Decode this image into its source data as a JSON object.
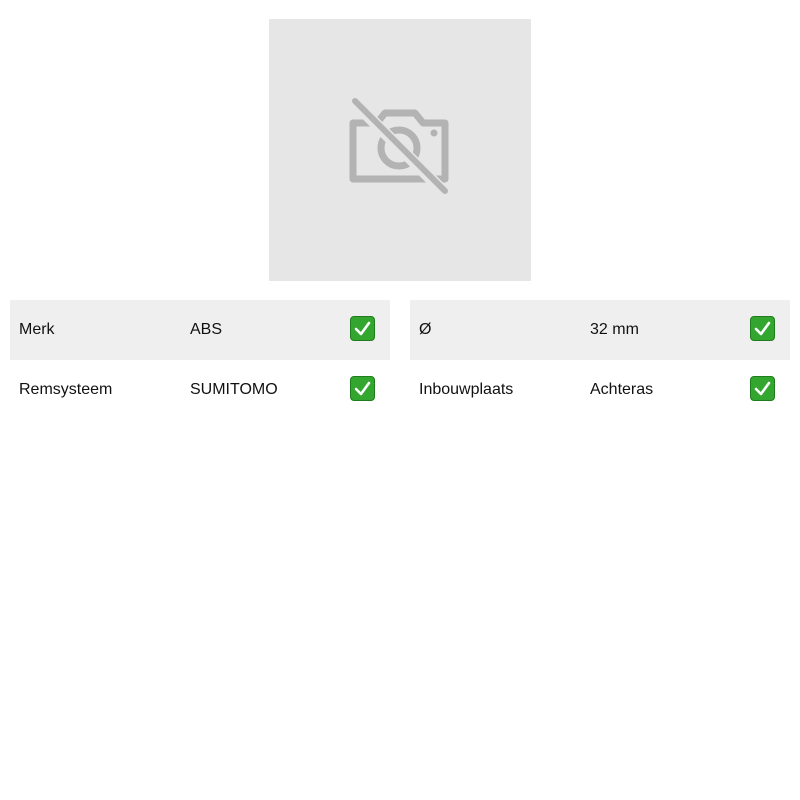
{
  "product_image": {
    "icon": "no-photo-icon"
  },
  "specs_left": [
    {
      "label": "Merk",
      "value": "ABS",
      "icon": "check-icon"
    },
    {
      "label": "Remsysteem",
      "value": "SUMITOMO",
      "icon": "check-icon"
    }
  ],
  "specs_right": [
    {
      "label": "Ø",
      "value": "32 mm",
      "icon": "check-icon"
    },
    {
      "label": "Inbouwplaats",
      "value": "Achteras",
      "icon": "check-icon"
    }
  ],
  "colors": {
    "check_green": "#33a630",
    "row_shade": "#efefef",
    "placeholder_bg": "#e6e6e6",
    "placeholder_icon": "#b3b3b3"
  }
}
